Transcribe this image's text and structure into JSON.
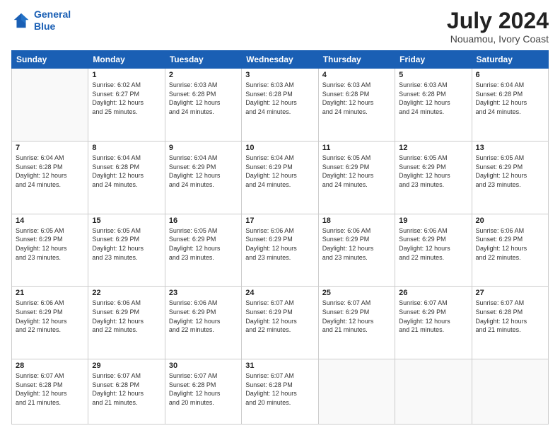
{
  "header": {
    "logo_line1": "General",
    "logo_line2": "Blue",
    "month_year": "July 2024",
    "location": "Nouamou, Ivory Coast"
  },
  "days_of_week": [
    "Sunday",
    "Monday",
    "Tuesday",
    "Wednesday",
    "Thursday",
    "Friday",
    "Saturday"
  ],
  "weeks": [
    [
      {
        "day": "",
        "info": ""
      },
      {
        "day": "1",
        "info": "Sunrise: 6:02 AM\nSunset: 6:27 PM\nDaylight: 12 hours\nand 25 minutes."
      },
      {
        "day": "2",
        "info": "Sunrise: 6:03 AM\nSunset: 6:28 PM\nDaylight: 12 hours\nand 24 minutes."
      },
      {
        "day": "3",
        "info": "Sunrise: 6:03 AM\nSunset: 6:28 PM\nDaylight: 12 hours\nand 24 minutes."
      },
      {
        "day": "4",
        "info": "Sunrise: 6:03 AM\nSunset: 6:28 PM\nDaylight: 12 hours\nand 24 minutes."
      },
      {
        "day": "5",
        "info": "Sunrise: 6:03 AM\nSunset: 6:28 PM\nDaylight: 12 hours\nand 24 minutes."
      },
      {
        "day": "6",
        "info": "Sunrise: 6:04 AM\nSunset: 6:28 PM\nDaylight: 12 hours\nand 24 minutes."
      }
    ],
    [
      {
        "day": "7",
        "info": "Sunrise: 6:04 AM\nSunset: 6:28 PM\nDaylight: 12 hours\nand 24 minutes."
      },
      {
        "day": "8",
        "info": "Sunrise: 6:04 AM\nSunset: 6:28 PM\nDaylight: 12 hours\nand 24 minutes."
      },
      {
        "day": "9",
        "info": "Sunrise: 6:04 AM\nSunset: 6:29 PM\nDaylight: 12 hours\nand 24 minutes."
      },
      {
        "day": "10",
        "info": "Sunrise: 6:04 AM\nSunset: 6:29 PM\nDaylight: 12 hours\nand 24 minutes."
      },
      {
        "day": "11",
        "info": "Sunrise: 6:05 AM\nSunset: 6:29 PM\nDaylight: 12 hours\nand 24 minutes."
      },
      {
        "day": "12",
        "info": "Sunrise: 6:05 AM\nSunset: 6:29 PM\nDaylight: 12 hours\nand 23 minutes."
      },
      {
        "day": "13",
        "info": "Sunrise: 6:05 AM\nSunset: 6:29 PM\nDaylight: 12 hours\nand 23 minutes."
      }
    ],
    [
      {
        "day": "14",
        "info": "Sunrise: 6:05 AM\nSunset: 6:29 PM\nDaylight: 12 hours\nand 23 minutes."
      },
      {
        "day": "15",
        "info": "Sunrise: 6:05 AM\nSunset: 6:29 PM\nDaylight: 12 hours\nand 23 minutes."
      },
      {
        "day": "16",
        "info": "Sunrise: 6:05 AM\nSunset: 6:29 PM\nDaylight: 12 hours\nand 23 minutes."
      },
      {
        "day": "17",
        "info": "Sunrise: 6:06 AM\nSunset: 6:29 PM\nDaylight: 12 hours\nand 23 minutes."
      },
      {
        "day": "18",
        "info": "Sunrise: 6:06 AM\nSunset: 6:29 PM\nDaylight: 12 hours\nand 23 minutes."
      },
      {
        "day": "19",
        "info": "Sunrise: 6:06 AM\nSunset: 6:29 PM\nDaylight: 12 hours\nand 22 minutes."
      },
      {
        "day": "20",
        "info": "Sunrise: 6:06 AM\nSunset: 6:29 PM\nDaylight: 12 hours\nand 22 minutes."
      }
    ],
    [
      {
        "day": "21",
        "info": "Sunrise: 6:06 AM\nSunset: 6:29 PM\nDaylight: 12 hours\nand 22 minutes."
      },
      {
        "day": "22",
        "info": "Sunrise: 6:06 AM\nSunset: 6:29 PM\nDaylight: 12 hours\nand 22 minutes."
      },
      {
        "day": "23",
        "info": "Sunrise: 6:06 AM\nSunset: 6:29 PM\nDaylight: 12 hours\nand 22 minutes."
      },
      {
        "day": "24",
        "info": "Sunrise: 6:07 AM\nSunset: 6:29 PM\nDaylight: 12 hours\nand 22 minutes."
      },
      {
        "day": "25",
        "info": "Sunrise: 6:07 AM\nSunset: 6:29 PM\nDaylight: 12 hours\nand 21 minutes."
      },
      {
        "day": "26",
        "info": "Sunrise: 6:07 AM\nSunset: 6:29 PM\nDaylight: 12 hours\nand 21 minutes."
      },
      {
        "day": "27",
        "info": "Sunrise: 6:07 AM\nSunset: 6:28 PM\nDaylight: 12 hours\nand 21 minutes."
      }
    ],
    [
      {
        "day": "28",
        "info": "Sunrise: 6:07 AM\nSunset: 6:28 PM\nDaylight: 12 hours\nand 21 minutes."
      },
      {
        "day": "29",
        "info": "Sunrise: 6:07 AM\nSunset: 6:28 PM\nDaylight: 12 hours\nand 21 minutes."
      },
      {
        "day": "30",
        "info": "Sunrise: 6:07 AM\nSunset: 6:28 PM\nDaylight: 12 hours\nand 20 minutes."
      },
      {
        "day": "31",
        "info": "Sunrise: 6:07 AM\nSunset: 6:28 PM\nDaylight: 12 hours\nand 20 minutes."
      },
      {
        "day": "",
        "info": ""
      },
      {
        "day": "",
        "info": ""
      },
      {
        "day": "",
        "info": ""
      }
    ]
  ]
}
